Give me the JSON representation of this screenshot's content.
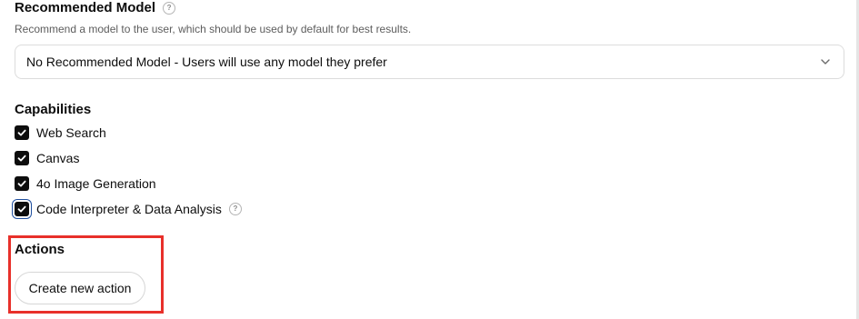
{
  "recommended_model": {
    "title": "Recommended Model",
    "help_icon": "question-circle-icon",
    "description": "Recommend a model to the user, which should be used by default for best results.",
    "selected_value": "No Recommended Model - Users will use any model they prefer",
    "dropdown_icon": "chevron-down-icon"
  },
  "capabilities": {
    "title": "Capabilities",
    "items": [
      {
        "label": "Web Search",
        "checked": true
      },
      {
        "label": "Canvas",
        "checked": true
      },
      {
        "label": "4o Image Generation",
        "checked": true
      },
      {
        "label": "Code Interpreter & Data Analysis",
        "checked": true,
        "focused": true,
        "help_icon": "question-circle-icon"
      }
    ]
  },
  "actions": {
    "title": "Actions",
    "button_label": "Create new action",
    "highlight_color": "#e8302a"
  }
}
